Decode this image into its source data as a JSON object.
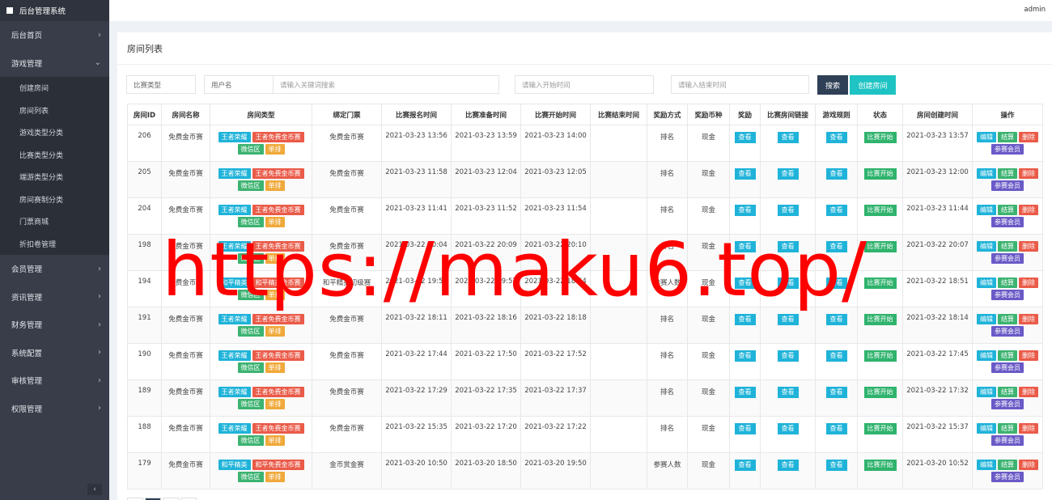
{
  "sidebar": {
    "title": "后台管理系统",
    "items": [
      {
        "label": "后台首页",
        "arrow": "›"
      },
      {
        "label": "游戏管理",
        "arrow": "⌄"
      }
    ],
    "sub_items": [
      "创建房间",
      "房间列表",
      "游戏类型分类",
      "比赛类型分类",
      "端游类型分类",
      "房间赛制分类",
      "门票商城",
      "折扣卷管理"
    ],
    "items_after": [
      {
        "label": "会员管理",
        "arrow": "›"
      },
      {
        "label": "资讯管理",
        "arrow": "›"
      },
      {
        "label": "财务管理",
        "arrow": "›"
      },
      {
        "label": "系统配置",
        "arrow": "›"
      },
      {
        "label": "审核管理",
        "arrow": "›"
      },
      {
        "label": "权限管理",
        "arrow": "›"
      }
    ],
    "collapse": "‹"
  },
  "topbar": {
    "user": "admin"
  },
  "panel": {
    "title": "房间列表"
  },
  "filters": {
    "type": "比赛类型",
    "field": "用户名",
    "keyword_placeholder": "请输入关键词搜索",
    "start_placeholder": "请输入开始时间",
    "end_placeholder": "请输入结束时间",
    "search": "搜索",
    "create": "创建房间"
  },
  "table": {
    "headers": [
      "房间ID",
      "房间名称",
      "房间类型",
      "绑定门票",
      "比赛报名时间",
      "比赛准备时间",
      "比赛开始时间",
      "比赛结束时间",
      "奖励方式",
      "奖励币种",
      "奖励",
      "比赛房间链接",
      "游戏规则",
      "状态",
      "房间创建时间",
      "操作"
    ],
    "view": "查看",
    "actions": {
      "edit": "编辑",
      "settle": "结算",
      "delete": "删除",
      "members": "参赛会员"
    },
    "rows": [
      {
        "id": "206",
        "name": "免费金币赛",
        "tags": [
          "王者荣耀",
          "王者免费金币赛",
          "微信区",
          "单排"
        ],
        "ticket": "免费金币赛",
        "signup": "2021-03-23 13:56",
        "prepare": "2021-03-23 13:59",
        "start": "2021-03-23 14:00",
        "end": "",
        "reward_mode": "排名",
        "currency": "现金",
        "status": "比赛开始",
        "created": "2021-03-23 13:57"
      },
      {
        "id": "205",
        "name": "免费金币赛",
        "tags": [
          "王者荣耀",
          "王者免费金币赛",
          "微信区",
          "单排"
        ],
        "ticket": "免费金币赛",
        "signup": "2021-03-23 11:58",
        "prepare": "2021-03-23 12:04",
        "start": "2021-03-23 12:05",
        "end": "",
        "reward_mode": "排名",
        "currency": "现金",
        "status": "比赛开始",
        "created": "2021-03-23 12:00"
      },
      {
        "id": "204",
        "name": "免费金币赛",
        "tags": [
          "王者荣耀",
          "王者免费金币赛",
          "微信区",
          "单排"
        ],
        "ticket": "免费金币赛",
        "signup": "2021-03-23 11:41",
        "prepare": "2021-03-23 11:52",
        "start": "2021-03-23 11:54",
        "end": "",
        "reward_mode": "排名",
        "currency": "现金",
        "status": "比赛开始",
        "created": "2021-03-23 11:44"
      },
      {
        "id": "198",
        "name": "免费金币赛",
        "tags": [
          "王者荣耀",
          "王者免费金币赛",
          "微信区",
          "单排"
        ],
        "ticket": "免费金币赛",
        "signup": "2021-03-22 20:04",
        "prepare": "2021-03-22 20:09",
        "start": "2021-03-22 20:10",
        "end": "",
        "reward_mode": "排名",
        "currency": "现金",
        "status": "比赛开始",
        "created": "2021-03-22 20:07"
      },
      {
        "id": "194",
        "name": "免费金币赛",
        "tags": [
          "和平精英",
          "和平精英金币赛",
          "微信区",
          "单排"
        ],
        "ticket": "和平精英初级赛",
        "signup": "2021-03-22 19:56",
        "prepare": "2021-03-22 19:57",
        "start": "2021-03-22 18:54",
        "end": "",
        "reward_mode": "参赛人数",
        "currency": "现金",
        "status": "比赛开始",
        "created": "2021-03-22 18:51"
      },
      {
        "id": "191",
        "name": "免费金币赛",
        "tags": [
          "王者荣耀",
          "王者免费金币赛",
          "微信区",
          "单排"
        ],
        "ticket": "免费金币赛",
        "signup": "2021-03-22 18:11",
        "prepare": "2021-03-22 18:16",
        "start": "2021-03-22 18:18",
        "end": "",
        "reward_mode": "排名",
        "currency": "现金",
        "status": "比赛开始",
        "created": "2021-03-22 18:14"
      },
      {
        "id": "190",
        "name": "免费金币赛",
        "tags": [
          "王者荣耀",
          "王者免费金币赛",
          "微信区",
          "单排"
        ],
        "ticket": "免费金币赛",
        "signup": "2021-03-22 17:44",
        "prepare": "2021-03-22 17:50",
        "start": "2021-03-22 17:52",
        "end": "",
        "reward_mode": "排名",
        "currency": "现金",
        "status": "比赛开始",
        "created": "2021-03-22 17:45"
      },
      {
        "id": "189",
        "name": "免费金币赛",
        "tags": [
          "王者荣耀",
          "王者免费金币赛",
          "微信区",
          "单排"
        ],
        "ticket": "免费金币赛",
        "signup": "2021-03-22 17:29",
        "prepare": "2021-03-22 17:35",
        "start": "2021-03-22 17:37",
        "end": "",
        "reward_mode": "排名",
        "currency": "现金",
        "status": "比赛开始",
        "created": "2021-03-22 17:32"
      },
      {
        "id": "188",
        "name": "免费金币赛",
        "tags": [
          "王者荣耀",
          "王者免费金币赛",
          "微信区",
          "单排"
        ],
        "ticket": "免费金币赛",
        "signup": "2021-03-22 15:35",
        "prepare": "2021-03-22 17:20",
        "start": "2021-03-22 17:22",
        "end": "",
        "reward_mode": "排名",
        "currency": "现金",
        "status": "比赛开始",
        "created": "2021-03-22 15:37"
      },
      {
        "id": "179",
        "name": "免费金币赛",
        "tags": [
          "和平精英",
          "和平免费金币赛",
          "微信区",
          "单排"
        ],
        "ticket": "金币赏金赛",
        "signup": "2021-03-20 10:50",
        "prepare": "2021-03-20 18:50",
        "start": "2021-03-20 19:50",
        "end": "",
        "reward_mode": "参赛人数",
        "currency": "现金",
        "status": "比赛开始",
        "created": "2021-03-20 10:52"
      }
    ]
  },
  "watermark": "https://maku6.top/",
  "colors": {
    "sidebar": "#393d49",
    "accent": "#1fb3d9",
    "danger": "#ea5b49",
    "success": "#2fb36d",
    "dark_button": "#2f4056",
    "create_button": "#1fc3c3"
  }
}
